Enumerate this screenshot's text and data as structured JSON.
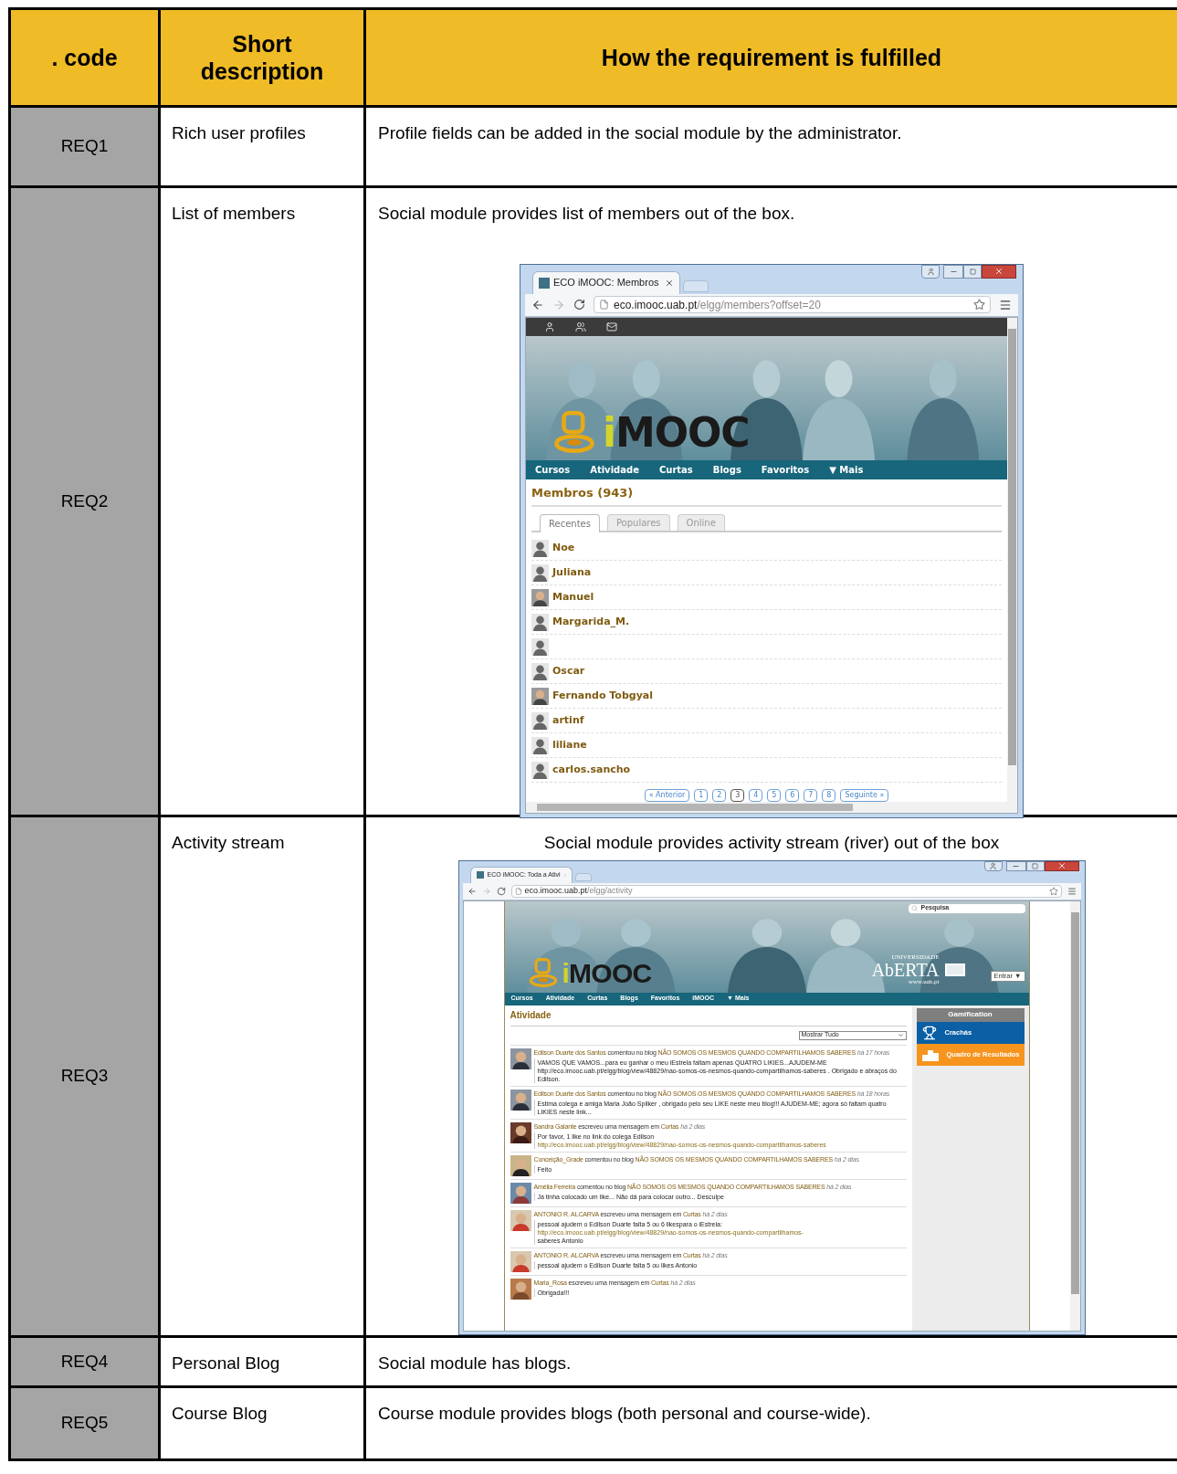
{
  "table": {
    "columns": [
      ". code",
      "Short description",
      "How the requirement is fulfilled"
    ],
    "rows": [
      {
        "code": "REQ1",
        "short": "Rich user profiles",
        "how": "Profile fields can be added in the social module by the administrator."
      },
      {
        "code": "REQ2",
        "short": "List of members",
        "how": "Social module provides list of members out of the box.",
        "screenshot": {
          "kind": "members",
          "tab_title": "ECO iMOOC: Membros",
          "url_host": "eco.imooc.uab.pt",
          "url_path": "/elgg/members?offset=20",
          "logo": "iMOOC",
          "nav": [
            "Cursos",
            "Atividade",
            "Curtas",
            "Blogs",
            "Favoritos",
            "▼ Mais"
          ],
          "heading": "Membros (943)",
          "tabs": [
            {
              "label": "Recentes",
              "selected": true
            },
            {
              "label": "Populares",
              "selected": false
            },
            {
              "label": "Online",
              "selected": false
            }
          ],
          "members": [
            {
              "name": "Noe",
              "kind": "default"
            },
            {
              "name": "Juliana",
              "kind": "default"
            },
            {
              "name": "Manuel"
            },
            {
              "name": "Margarida_M.",
              "kind": "default"
            },
            {
              "kind": "default"
            },
            {
              "name": "Oscar",
              "kind": "default"
            },
            {
              "name": "Fernando Tobgyal"
            },
            {
              "name": "artinf",
              "kind": "default"
            },
            {
              "name": "liliane",
              "kind": "default"
            },
            {
              "name": "carlos.sancho",
              "kind": "default"
            }
          ],
          "pagination": {
            "prev": "« Anterior",
            "next": "Seguinte »",
            "pages": [
              {
                "label": "1",
                "selected": false
              },
              {
                "label": "2",
                "selected": false
              },
              {
                "label": "3",
                "selected": true
              },
              {
                "label": "4",
                "selected": false
              },
              {
                "label": "5",
                "selected": false
              },
              {
                "label": "6",
                "selected": false
              },
              {
                "label": "7",
                "selected": false
              },
              {
                "label": "8",
                "selected": false
              }
            ]
          }
        }
      },
      {
        "code": "REQ3",
        "short": "Activity stream",
        "how": "Social module provides activity stream (river) out of the box",
        "screenshot": {
          "kind": "activity",
          "tab_title": "ECO iMOOC: Toda a Ativi",
          "url_host": "eco.imooc.uab.pt",
          "url_path": "/elgg/activity",
          "search_placeholder": "Pesquisa",
          "logo": "iMOOC",
          "university": {
            "top": "UNIVERSIDADE",
            "name": "AbERTA",
            "url": "www.uab.pt"
          },
          "login": "Entrar ▼",
          "nav": [
            "Cursos",
            "Atividade",
            "Curtas",
            "Blogs",
            "Favoritos",
            "iMOOC",
            "▼ Mais"
          ],
          "heading": "Atividade",
          "filter": "Mostrar Tudo",
          "sidebar": {
            "title": "Gamification",
            "items": [
              {
                "label": "Crachás",
                "kind": "trophy",
                "color": "#0b5fa5"
              },
              {
                "label": "Quadro de Resultados",
                "kind": "podium",
                "color": "#f7941d"
              }
            ]
          },
          "items": [
            {
              "author": "Edilson Duarte dos Santos",
              "action": "comentou no blog",
              "target": "NÃO SOMOS OS MESMOS QUANDO COMPARTILHAMOS SABERES",
              "time": "há 17 horas",
              "body": [
                {
                  "kind": "text",
                  "text": "VAMOS QUE VAMOS...para eu ganhar o meu iEstrela faltam apenas QUATRO LIKIES...AJUDEM-ME http://eco.imooc.uab.pt/elgg/blog/view/48829/nao-somos-os-nesmos-quando-compartilhamos-saberes . Obrigado e abraços do Edilson."
                }
              ]
            },
            {
              "author": "Edilson Duarte dos Santos",
              "action": "comentou no blog",
              "target": "NÃO SOMOS OS MESMOS QUANDO COMPARTILHAMOS SABERES",
              "time": "há 18 horas",
              "body": [
                {
                  "kind": "text",
                  "text": "Estima colega e amiga Maria João Spilker , obrigado pelo seu LIKE neste meu blog!!! AJUDEM-ME; agora só faltam quatro LIKIES neste link..."
                }
              ]
            },
            {
              "author": "Sandra Galante",
              "action": "escreveu uma mensagem em",
              "target": "Curtas",
              "time": "há 2 dias",
              "body": [
                {
                  "kind": "text",
                  "text": "Por favor, 1 like no link do colega Edilson "
                },
                {
                  "kind": "link",
                  "text": "http://eco.imooc.uab.pt/elgg/blog/view/48829/nao-somos-os-nesmos-quando-compartilhamos-saberes"
                }
              ]
            },
            {
              "author": "Conceição_Grade",
              "action": "comentou no blog",
              "target": "NÃO SOMOS OS MESMOS QUANDO COMPARTILHAMOS SABERES",
              "time": "há 2 dias",
              "body": [
                {
                  "kind": "text",
                  "text": "Feito"
                }
              ]
            },
            {
              "author": "Amélia Ferreira",
              "action": "comentou no blog",
              "target": "NÃO SOMOS OS MESMOS QUANDO COMPARTILHAMOS SABERES",
              "time": "há 2 dias",
              "body": [
                {
                  "kind": "text",
                  "text": "Já tinha colocado um like... Não dá para colocar outro... Desculpe"
                }
              ]
            },
            {
              "author": "ANTONIO R. ALCARVA",
              "action": "escreveu uma mensagem em",
              "target": "Curtas",
              "time": "há 2 dias",
              "body": [
                {
                  "kind": "text",
                  "text": "pessoal ajudem o Edilson Duarte falta 5 ou 6 likespara o iEstrela: "
                },
                {
                  "kind": "link",
                  "text": "http://eco.imooc.uab.pt/elgg/blog/view/48829/nao-somos-os-nesmos-quando-compartilhamos-"
                },
                {
                  "kind": "text",
                  "text": " saberes Antonio"
                }
              ]
            },
            {
              "author": "ANTONIO R. ALCARVA",
              "action": "escreveu uma mensagem em",
              "target": "Curtas",
              "time": "há 2 dias",
              "body": [
                {
                  "kind": "text",
                  "text": "pessoal ajudem o Edilson Duarte falta 5 ou likes Antonio"
                }
              ]
            },
            {
              "author": "Maria_Rosa",
              "action": "escreveu uma mensagem em",
              "target": "Curtas",
              "time": "há 2 dias",
              "body": [
                {
                  "kind": "text",
                  "text": "Obrigada!!!"
                }
              ]
            }
          ]
        }
      },
      {
        "code": "REQ4",
        "short": "Personal Blog",
        "how": "Social module has blogs."
      },
      {
        "code": "REQ5",
        "short": "Course Blog",
        "how": "Course module provides blogs (both personal and course-wide)."
      }
    ]
  }
}
